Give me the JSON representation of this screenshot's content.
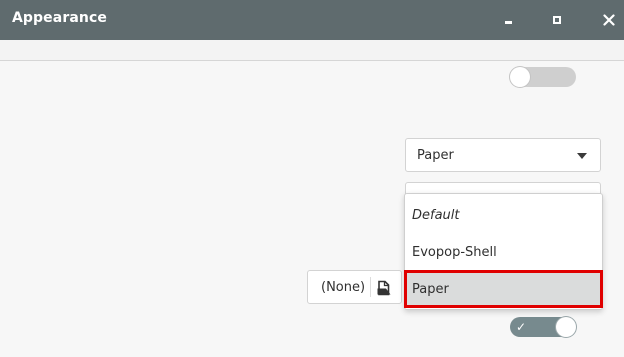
{
  "window": {
    "title": "Appearance",
    "controls": {
      "minimize_icon": "minimize-icon",
      "maximize_icon": "maximize-icon",
      "close_icon": "close-icon"
    }
  },
  "settings": {
    "top_switch": {
      "state": "off"
    },
    "theme_combo": {
      "selected": "Paper"
    },
    "icon_file": {
      "label": "(None)"
    },
    "bottom_switch": {
      "state": "on",
      "check_glyph": "✓"
    }
  },
  "dropdown": {
    "items": [
      {
        "label": "Default",
        "style": "italic"
      },
      {
        "label": "Evopop-Shell"
      },
      {
        "label": "Paper",
        "selected": true
      }
    ]
  },
  "colors": {
    "titlebar": "#5f6b6e",
    "highlight": "#e00000",
    "switch_on": "#778a8e",
    "switch_off": "#cfcfcf"
  }
}
